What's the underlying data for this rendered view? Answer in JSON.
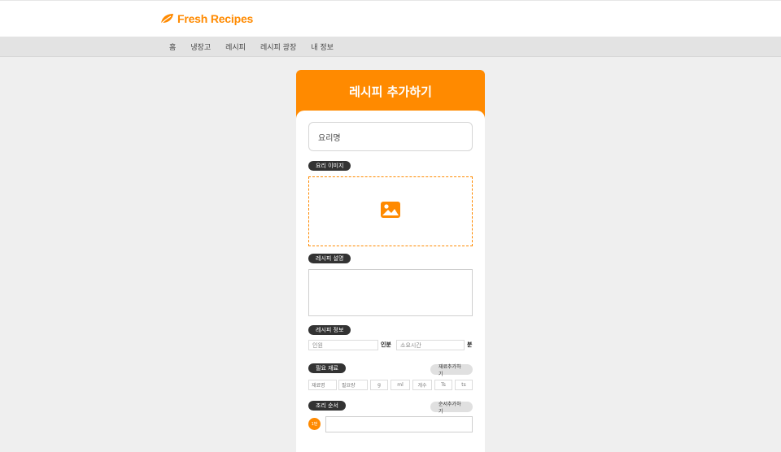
{
  "header": {
    "brand": "Fresh Recipes",
    "brand_icon": "leaf-icon"
  },
  "nav": {
    "items": [
      "홈",
      "냉장고",
      "레시피",
      "레시피 광장",
      "내 정보"
    ]
  },
  "form": {
    "title": "레시피 추가하기",
    "name_placeholder": "요리명",
    "image_label": "요리 이미지",
    "image_icon": "image-icon",
    "description_label": "레시피 설명",
    "info_label": "레시피 정보",
    "servings_placeholder": "인원",
    "servings_unit": "인분",
    "time_placeholder": "소요시간",
    "time_unit": "분",
    "ingredients_label": "필요 재료",
    "add_ingredient_label": "재료추가하기",
    "ingredient_name_placeholder": "재료명",
    "ingredient_amount_placeholder": "필요량",
    "unit_options": [
      "g",
      "ml",
      "개수",
      "Ts",
      "ts"
    ],
    "steps_label": "조리 순서",
    "add_step_label": "순서추가하기",
    "steps": [
      {
        "number": "1번"
      }
    ]
  },
  "colors": {
    "accent": "#ff8a00",
    "dark_pill": "#333333",
    "page_bg": "#efefef"
  }
}
